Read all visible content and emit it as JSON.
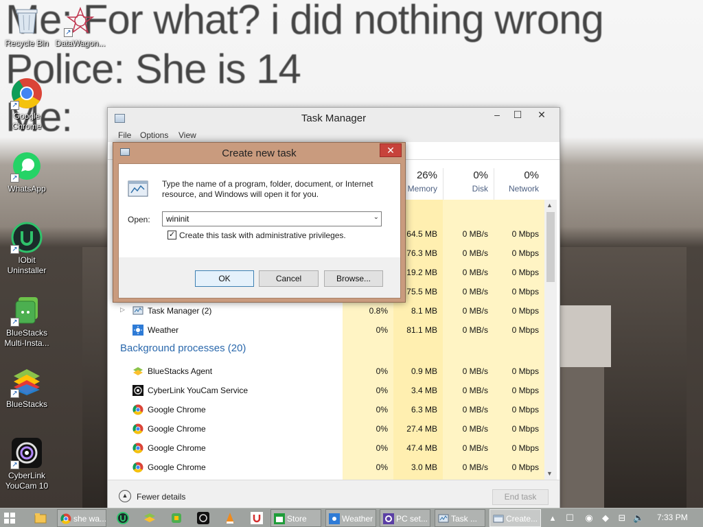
{
  "wallpaper": {
    "lines": [
      "Me: For what? i did nothing wrong",
      "Police: She is 14",
      "Me:"
    ]
  },
  "desktop_icons": [
    {
      "label": "Recycle Bin",
      "icon": "recycle-bin-icon"
    },
    {
      "label": "DataWagon...",
      "icon": "datawagon-icon"
    },
    {
      "label": "Google Chrome",
      "icon": "chrome-icon"
    },
    {
      "label": "WhatsApp",
      "icon": "whatsapp-icon"
    },
    {
      "label": "IObit Uninstaller",
      "icon": "iobit-uninstaller-icon"
    },
    {
      "label": "BlueStacks Multi-Insta...",
      "icon": "bluestacks-multi-instance-icon"
    },
    {
      "label": "BlueStacks",
      "icon": "bluestacks-icon"
    },
    {
      "label": "CyberLink YouCam 10",
      "icon": "cyberlink-youcam-icon"
    }
  ],
  "task_manager": {
    "title": "Task Manager",
    "menu": [
      "File",
      "Options",
      "View"
    ],
    "columns": [
      {
        "pct": "26%",
        "name": "Memory"
      },
      {
        "pct": "0%",
        "name": "Disk"
      },
      {
        "pct": "0%",
        "name": "Network"
      }
    ],
    "app_rows": [
      {
        "name": "",
        "cpu": "",
        "memory": "64.5 MB",
        "disk": "0 MB/s",
        "network": "0 Mbps"
      },
      {
        "name": "",
        "cpu": "",
        "memory": "76.3 MB",
        "disk": "0 MB/s",
        "network": "0 Mbps"
      },
      {
        "name": "",
        "cpu": "",
        "memory": "19.2 MB",
        "disk": "0 MB/s",
        "network": "0 Mbps"
      },
      {
        "name": "",
        "cpu": "",
        "memory": "75.5 MB",
        "disk": "0 MB/s",
        "network": "0 Mbps"
      },
      {
        "name": "Task Manager (2)",
        "cpu": "0.8%",
        "memory": "8.1 MB",
        "disk": "0 MB/s",
        "network": "0 Mbps"
      },
      {
        "name": "Weather",
        "cpu": "0%",
        "memory": "81.1 MB",
        "disk": "0 MB/s",
        "network": "0 Mbps"
      }
    ],
    "bg_section_label": "Background processes (20)",
    "bg_rows": [
      {
        "name": "BlueStacks Agent",
        "cpu": "0%",
        "memory": "0.9 MB",
        "disk": "0 MB/s",
        "network": "0 Mbps"
      },
      {
        "name": "CyberLink YouCam Service",
        "cpu": "0%",
        "memory": "3.4 MB",
        "disk": "0 MB/s",
        "network": "0 Mbps"
      },
      {
        "name": "Google Chrome",
        "cpu": "0%",
        "memory": "6.3 MB",
        "disk": "0 MB/s",
        "network": "0 Mbps"
      },
      {
        "name": "Google Chrome",
        "cpu": "0%",
        "memory": "27.4 MB",
        "disk": "0 MB/s",
        "network": "0 Mbps"
      },
      {
        "name": "Google Chrome",
        "cpu": "0%",
        "memory": "47.4 MB",
        "disk": "0 MB/s",
        "network": "0 Mbps"
      },
      {
        "name": "Google Chrome",
        "cpu": "0%",
        "memory": "3.0 MB",
        "disk": "0 MB/s",
        "network": "0 Mbps"
      }
    ],
    "footer": {
      "fewer_details": "Fewer details",
      "end_task": "End task"
    }
  },
  "dialog": {
    "title": "Create new task",
    "close_glyph": "✕",
    "description": "Type the name of a program, folder, document, or Internet resource, and Windows will open it for you.",
    "open_label": "Open:",
    "open_value": "wininit",
    "admin_checkbox_label": "Create this task with administrative privileges.",
    "admin_checked": true,
    "ok": "OK",
    "cancel": "Cancel",
    "browse": "Browse..."
  },
  "taskbar": {
    "items": [
      {
        "label": "she wa...",
        "icon": "chrome-icon",
        "active": false
      },
      {
        "label": "Store",
        "icon": "store-icon",
        "active": false
      },
      {
        "label": "Weather",
        "icon": "weather-icon",
        "active": false
      },
      {
        "label": "PC set...",
        "icon": "pc-settings-icon",
        "active": false
      },
      {
        "label": "Task ...",
        "icon": "task-manager-icon",
        "active": false
      },
      {
        "label": "Create...",
        "icon": "run-icon",
        "active": true
      }
    ],
    "clock": "7:33 PM"
  },
  "colors": {
    "dialog_frame": "#c99b7e",
    "section_blue": "#2a68ac",
    "cpu_band": "#fff4c4",
    "memory_band": "#ffefb0",
    "close_red": "#c7433b"
  }
}
